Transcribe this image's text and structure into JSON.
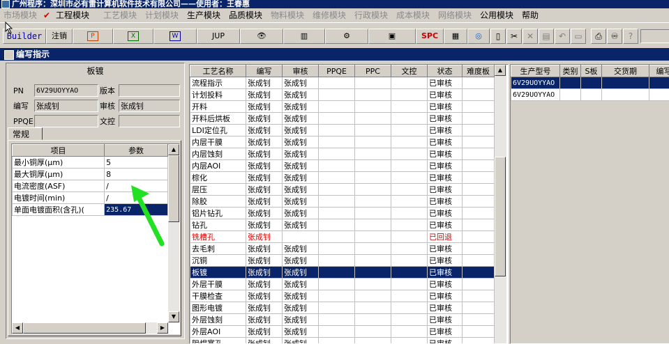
{
  "title": "广州程序：深圳市必有雷计算机软件技术有限公司——使用者：王春惠",
  "menu": [
    {
      "label": "市场模块",
      "enabled": false
    },
    {
      "label": "工程模块",
      "enabled": true,
      "checked": true
    },
    {
      "label": "工艺模块",
      "enabled": false
    },
    {
      "label": "计划模块",
      "enabled": false
    },
    {
      "label": "生产模块",
      "enabled": true
    },
    {
      "label": "品质模块",
      "enabled": true
    },
    {
      "label": "物料模块",
      "enabled": false
    },
    {
      "label": "维修模块",
      "enabled": false
    },
    {
      "label": "行政模块",
      "enabled": false
    },
    {
      "label": "成本模块",
      "enabled": false
    },
    {
      "label": "网络模块",
      "enabled": false
    },
    {
      "label": "公用模块",
      "enabled": true
    },
    {
      "label": "帮助",
      "enabled": true
    }
  ],
  "toolbar": {
    "builder_label": "Builder",
    "logout_label": "注销",
    "jup_label": "JUP",
    "spc_label": "SPC",
    "ppt_glyph": "P",
    "excel_glyph": "X",
    "word_glyph": "W"
  },
  "window_title": "编写指示",
  "left": {
    "section_title": "板镀",
    "labels": {
      "pn": "PN",
      "version": "版本",
      "writer": "编写",
      "reviewer": "审核",
      "ppqe": "PPQE",
      "doc_control": "文控"
    },
    "values": {
      "pn": "6V29UOYYAO",
      "version": "",
      "writer": "张成钊",
      "reviewer": "张成钊",
      "ppqe": "",
      "doc_control": ""
    },
    "tab_label": "常规",
    "param_headers": [
      "项目",
      "参数"
    ],
    "params": [
      {
        "item": "最小铜厚(μm)",
        "value": "5"
      },
      {
        "item": "最大铜厚(μm)",
        "value": "8"
      },
      {
        "item": "电流密度(ASF)",
        "value": "/"
      },
      {
        "item": "电镀时间(min)",
        "value": "/"
      },
      {
        "item": "单面电镀面积(含孔)(",
        "value": "235.67"
      }
    ]
  },
  "process": {
    "headers": [
      "工艺名称",
      "编写",
      "审核",
      "PPQE",
      "PPC",
      "文控",
      "状态",
      "难度板"
    ],
    "rows": [
      [
        "流程指示",
        "张成钊",
        "张成钊",
        "",
        "",
        "",
        "已审核",
        ""
      ],
      [
        "计划投料",
        "张成钊",
        "张成钊",
        "",
        "",
        "",
        "已审核",
        ""
      ],
      [
        "开料",
        "张成钊",
        "张成钊",
        "",
        "",
        "",
        "已审核",
        ""
      ],
      [
        "开料后烘板",
        "张成钊",
        "张成钊",
        "",
        "",
        "",
        "已审核",
        ""
      ],
      [
        "LDI定位孔",
        "张成钊",
        "张成钊",
        "",
        "",
        "",
        "已审核",
        ""
      ],
      [
        "内层干膜",
        "张成钊",
        "张成钊",
        "",
        "",
        "",
        "已审核",
        ""
      ],
      [
        "内层蚀刻",
        "张成钊",
        "张成钊",
        "",
        "",
        "",
        "已审核",
        ""
      ],
      [
        "内层AOI",
        "张成钊",
        "张成钊",
        "",
        "",
        "",
        "已审核",
        ""
      ],
      [
        "棕化",
        "张成钊",
        "张成钊",
        "",
        "",
        "",
        "已审核",
        ""
      ],
      [
        "层压",
        "张成钊",
        "张成钊",
        "",
        "",
        "",
        "已审核",
        ""
      ],
      [
        "除胶",
        "张成钊",
        "张成钊",
        "",
        "",
        "",
        "已审核",
        ""
      ],
      [
        "铝片钻孔",
        "张成钊",
        "张成钊",
        "",
        "",
        "",
        "已审核",
        ""
      ],
      [
        "钻孔",
        "张成钊",
        "张成钊",
        "",
        "",
        "",
        "已审核",
        ""
      ],
      [
        "铣槽孔",
        "张成钊",
        "",
        "",
        "",
        "",
        "已回退",
        ""
      ],
      [
        "去毛刺",
        "张成钊",
        "张成钊",
        "",
        "",
        "",
        "已审核",
        ""
      ],
      [
        "沉铜",
        "张成钊",
        "张成钊",
        "",
        "",
        "",
        "已审核",
        ""
      ],
      [
        "板镀",
        "张成钊",
        "张成钊",
        "",
        "",
        "",
        "已审核",
        ""
      ],
      [
        "外层干膜",
        "张成钊",
        "张成钊",
        "",
        "",
        "",
        "已审核",
        ""
      ],
      [
        "干膜检查",
        "张成钊",
        "张成钊",
        "",
        "",
        "",
        "已审核",
        ""
      ],
      [
        "图形电镀",
        "张成钊",
        "张成钊",
        "",
        "",
        "",
        "已审核",
        ""
      ],
      [
        "外层蚀刻",
        "张成钊",
        "张成钊",
        "",
        "",
        "",
        "已审核",
        ""
      ],
      [
        "外层AOI",
        "张成钊",
        "张成钊",
        "",
        "",
        "",
        "已审核",
        ""
      ],
      [
        "阻焊塞孔",
        "张成钊",
        "张成钊",
        "",
        "",
        "",
        "已审核",
        ""
      ]
    ],
    "selected_index": 16,
    "returned_index": 13
  },
  "right": {
    "headers": [
      "生产型号",
      "类别",
      "S板",
      "交货期",
      "编写"
    ],
    "rows": [
      [
        "6V29UOYYAO",
        "",
        "",
        "",
        ""
      ],
      [
        "6V29UOYYAO",
        "",
        "",
        "",
        ""
      ]
    ]
  },
  "colors": {
    "title_bg": "#0a246a",
    "selection_bg": "#0a246a",
    "returned_text": "#e00000",
    "window_bg": "#d4d0c8"
  }
}
